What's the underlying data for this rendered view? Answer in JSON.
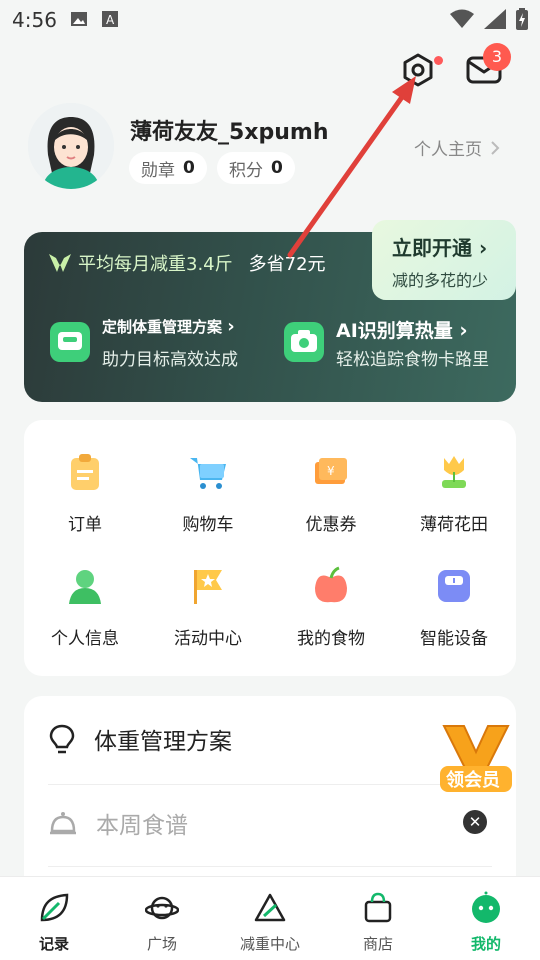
{
  "status_bar": {
    "time": "4:56"
  },
  "header": {
    "mail_badge": "3"
  },
  "profile": {
    "username": "薄荷友友_5xpumh",
    "medal_label": "勋章",
    "medal_count": "0",
    "points_label": "积分",
    "points_count": "0",
    "homepage_link": "个人主页"
  },
  "vip": {
    "slogan": "平均每月减重3.4斤",
    "saving": "多省72元",
    "open_title": "立即开通",
    "open_sub": "减的多花的少",
    "features": [
      {
        "title": "定制体重管理方案",
        "subtitle": "助力目标高效达成"
      },
      {
        "title": "AI识别算热量",
        "subtitle": "轻松追踪食物卡路里"
      }
    ]
  },
  "grid": {
    "items": [
      {
        "label": "订单",
        "icon": "clipboard-icon"
      },
      {
        "label": "购物车",
        "icon": "shopping-cart-icon"
      },
      {
        "label": "优惠券",
        "icon": "coupon-icon"
      },
      {
        "label": "薄荷花田",
        "icon": "tulip-icon"
      },
      {
        "label": "个人信息",
        "icon": "person-icon"
      },
      {
        "label": "活动中心",
        "icon": "star-flag-icon"
      },
      {
        "label": "我的食物",
        "icon": "apple-icon"
      },
      {
        "label": "智能设备",
        "icon": "scale-icon"
      }
    ]
  },
  "list": {
    "plan_label": "体重管理方案",
    "recipe_label": "本周食谱",
    "floater_text": "领会员"
  },
  "tabs": [
    {
      "label": "记录",
      "icon": "leaf-icon"
    },
    {
      "label": "广场",
      "icon": "planet-icon"
    },
    {
      "label": "减重中心",
      "icon": "triangle-icon"
    },
    {
      "label": "商店",
      "icon": "shopping-bag-icon"
    },
    {
      "label": "我的",
      "icon": "face-icon"
    }
  ],
  "colors": {
    "accent": "#13b86b",
    "badge": "#ff5a4f",
    "arrow": "#e0403a"
  }
}
